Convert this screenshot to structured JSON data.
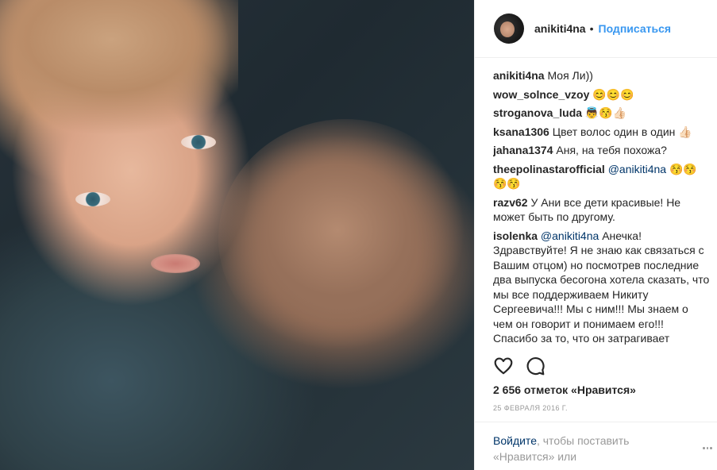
{
  "post": {
    "author": "anikiti4na",
    "dot": "•",
    "follow_label": "Подписаться"
  },
  "comments": [
    {
      "author": "anikiti4na",
      "text": "Моя Ли))"
    },
    {
      "author": "wow_solnce_vzoy",
      "text": "😊😊😊"
    },
    {
      "author": "stroganova_luda",
      "text": "👼😚👍🏻"
    },
    {
      "author": "ksana1306",
      "text": "Цвет волос один в один 👍🏻"
    },
    {
      "author": "jahana1374",
      "text": "Аня, на тебя похожа?"
    },
    {
      "author": "theepolinastarofficial",
      "mention": "@anikiti4na",
      "text": "😚😚😚😚"
    },
    {
      "author": "razv62",
      "text": "У Ани все дети красивые! Не может быть по другому."
    },
    {
      "author": "isolenka",
      "mention": "@anikiti4na",
      "text": "Анечка! Здравствуйте! Я не знаю как связаться с Вашим отцом) но посмотрев последние два выпуска бесогона хотела сказать, что мы все поддерживаем Никиту Сергеевича!!! Мы с ним!!! Мы знаем о чем он говорит и понимаем его!!! Спасибо за то, что он затрагивает подобные темы...Может это глупо, но я"
    }
  ],
  "likes_text": "2 656 отметок «Нравится»",
  "date_text": "25 ФЕВРАЛЯ 2016 Г.",
  "footer": {
    "login_link": "Войдите",
    "rest_text": ", чтобы поставить «Нравится» или прокомментировать."
  },
  "icons": {
    "like": "heart-icon",
    "comment": "comment-icon",
    "more": "more-options-icon"
  }
}
